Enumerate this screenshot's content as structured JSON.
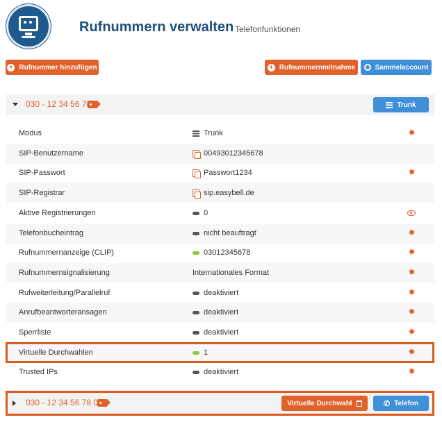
{
  "header": {
    "title": "Rufnummern verwalten",
    "subtitle": "Telefonfunktionen"
  },
  "toolbar": {
    "add_number_label": "Rufnummer hinzufügen",
    "porting_label": "Rufnummernmitnahme",
    "collective_label": "Sammelaccount"
  },
  "number1": {
    "number": "030 - 12 34 56 78",
    "mode_button_label": "Trunk",
    "rows": [
      {
        "label": "Modus",
        "value": "Trunk",
        "icon": "list-icon",
        "action": "gear-icon"
      },
      {
        "label": "SIP-Benutzername",
        "value": "00493012345678",
        "icon": "copy-icon",
        "action": ""
      },
      {
        "label": "SIP-Passwort",
        "value": "Passwort1234",
        "icon": "copy-icon",
        "action": "gear-icon"
      },
      {
        "label": "SIP-Registrar",
        "value": "sip.easybell.de",
        "icon": "copy-icon",
        "action": ""
      },
      {
        "label": "Aktive Registrierungen",
        "value": "0",
        "icon": "status-off-icon",
        "action": "eye-icon"
      },
      {
        "label": "Telefonbucheintrag",
        "value": "nicht beauftragt",
        "icon": "status-off-icon",
        "action": "gear-icon"
      },
      {
        "label": "Rufnummernanzeige (CLIP)",
        "value": "03012345678",
        "icon": "status-on-icon",
        "action": "gear-icon"
      },
      {
        "label": "Rufnummernsignalisierung",
        "value": "Internationales Format",
        "icon": "",
        "action": "gear-icon"
      },
      {
        "label": "Rufweiterleitung/Parallelruf",
        "value": "deaktiviert",
        "icon": "status-off-icon",
        "action": "gear-icon"
      },
      {
        "label": "Anrufbeantworteransagen",
        "value": "deaktiviert",
        "icon": "status-off-icon",
        "action": "gear-icon"
      },
      {
        "label": "Sperrliste",
        "value": "deaktiviert",
        "icon": "status-off-icon",
        "action": "gear-icon"
      },
      {
        "label": "Virtuelle Durchwahlen",
        "value": "1",
        "icon": "status-on-icon",
        "action": "gear-icon"
      },
      {
        "label": "Trusted IPs",
        "value": "deaktiviert",
        "icon": "status-off-icon",
        "action": "gear-icon"
      }
    ]
  },
  "number2": {
    "number": "030 - 12 34 56 78 01",
    "virtual_label": "Virtuelle Durchwahl",
    "phone_label": "Telefon"
  },
  "colors": {
    "accent_orange": "#e0612a",
    "accent_blue": "#3f8fd9",
    "title_blue": "#1f4e79",
    "status_on": "#8cc63f",
    "status_off": "#555555"
  }
}
